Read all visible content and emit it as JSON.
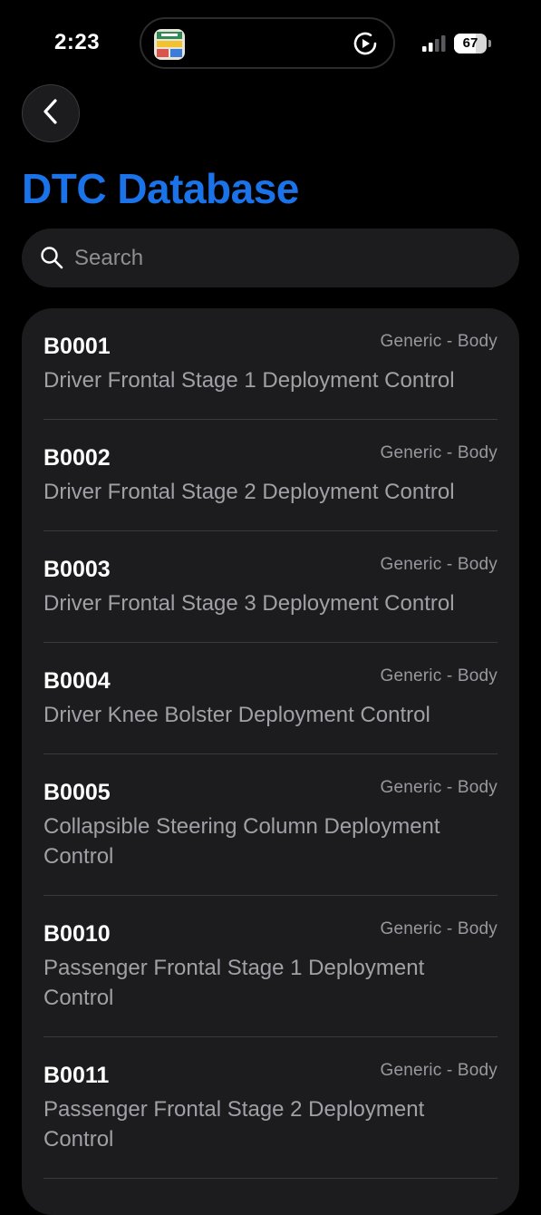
{
  "status_bar": {
    "time": "2:23",
    "battery_level": "67",
    "battery_fraction": 0.67
  },
  "nav": {
    "back_icon": "chevron-left-icon",
    "title": "DTC Database"
  },
  "search": {
    "icon": "search-icon",
    "placeholder": "Search",
    "value": ""
  },
  "colors": {
    "accent": "#1a73e8",
    "background": "#000000",
    "card": "#1c1c1e",
    "secondary_text": "#98989f"
  },
  "dtc_list": [
    {
      "code": "B0001",
      "category": "Generic - Body",
      "description": "Driver Frontal Stage 1 Deployment Control"
    },
    {
      "code": "B0002",
      "category": "Generic - Body",
      "description": "Driver Frontal Stage 2 Deployment Control"
    },
    {
      "code": "B0003",
      "category": "Generic - Body",
      "description": "Driver Frontal Stage 3 Deployment Control"
    },
    {
      "code": "B0004",
      "category": "Generic - Body",
      "description": "Driver Knee Bolster Deployment Control"
    },
    {
      "code": "B0005",
      "category": "Generic - Body",
      "description": "Collapsible Steering Column Deployment Control"
    },
    {
      "code": "B0010",
      "category": "Generic - Body",
      "description": "Passenger Frontal Stage 1 Deployment Control"
    },
    {
      "code": "B0011",
      "category": "Generic - Body",
      "description": "Passenger Frontal Stage 2 Deployment Control"
    }
  ]
}
